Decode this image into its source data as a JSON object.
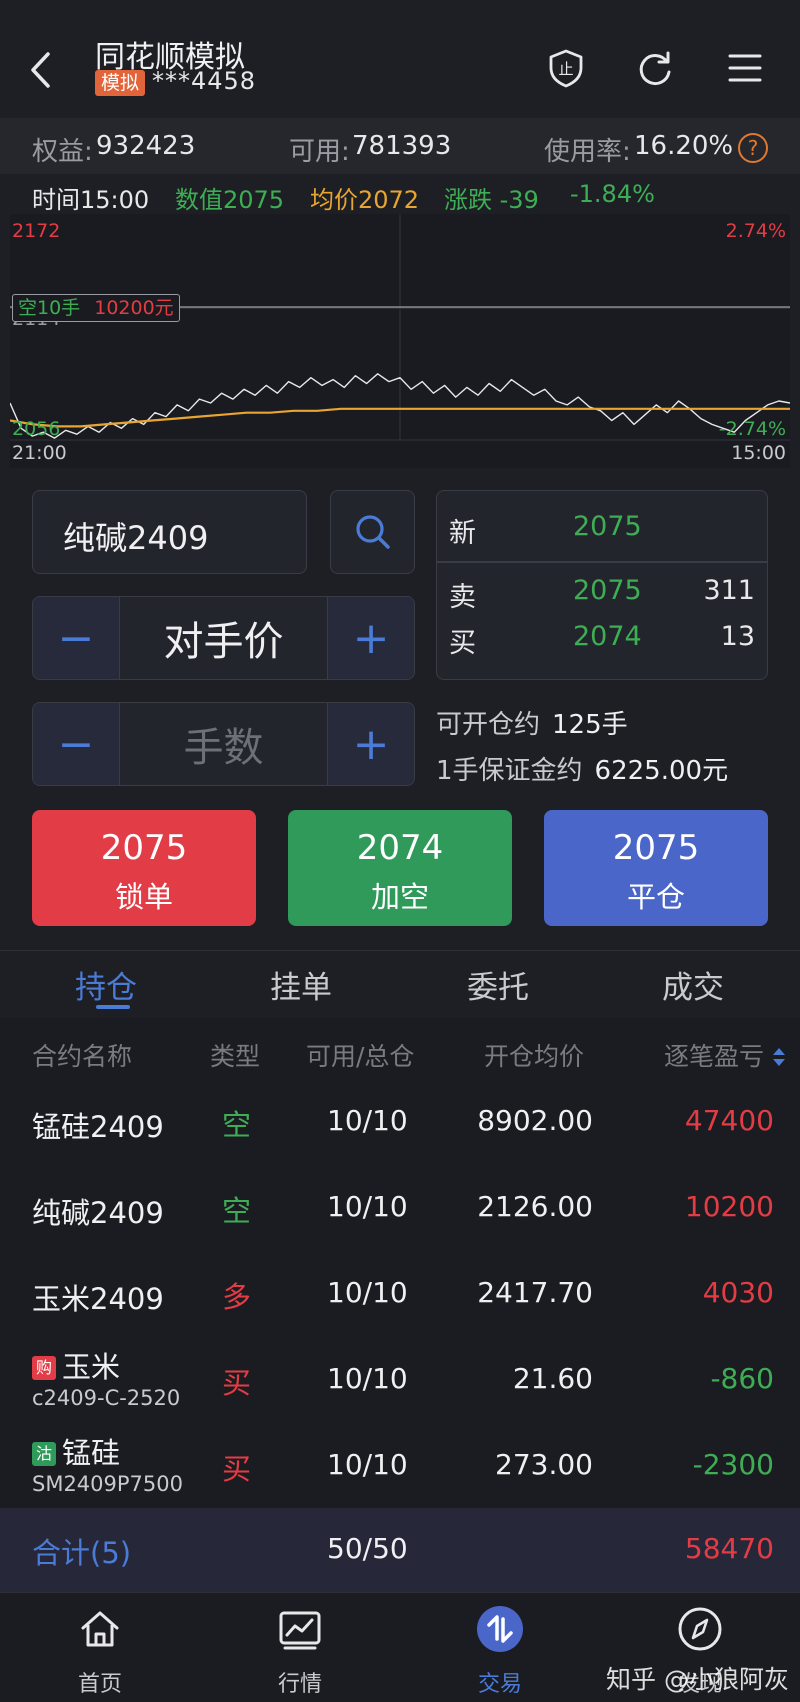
{
  "header": {
    "title": "同花顺模拟",
    "mode_badge": "模拟",
    "account": "***4458"
  },
  "account_bar": {
    "equity_label": "权益:",
    "equity_value": "932423",
    "available_label": "可用:",
    "available_value": "781393",
    "usage_label": "使用率:",
    "usage_value": "16.20%",
    "help": "?"
  },
  "quote_line": {
    "time": "时间15:00",
    "value": "数值2075",
    "avg": "均价2072",
    "change": "涨跌 -39",
    "change_pct": "-1.84%"
  },
  "chart_data": {
    "type": "line",
    "y_top_label": "2172",
    "y_mid_label": "2114",
    "y_bottom_label": "2056",
    "pct_top_label": "2.74%",
    "pct_bottom_label": "-2.74%",
    "x_start_label": "21:00",
    "x_end_label": "15:00",
    "position_tag_side": "空10手",
    "position_tag_value": "10200元",
    "position_line_price": 2126,
    "ylim": [
      2056,
      2172
    ],
    "series": [
      {
        "values": [
          2075,
          2062,
          2058,
          2060,
          2057,
          2061,
          2059,
          2063,
          2060,
          2065,
          2062,
          2067,
          2064,
          2070,
          2068,
          2074,
          2071,
          2077,
          2075,
          2080,
          2077,
          2082,
          2079,
          2084,
          2080,
          2086,
          2083,
          2088,
          2084,
          2087,
          2083,
          2089,
          2085,
          2090,
          2086,
          2088,
          2082,
          2086,
          2080,
          2084,
          2078,
          2083,
          2079,
          2085,
          2081,
          2087,
          2083,
          2079,
          2082,
          2076,
          2074,
          2078,
          2073,
          2071,
          2066,
          2070,
          2064,
          2069,
          2074,
          2070,
          2076,
          2072,
          2067,
          2064,
          2062,
          2060,
          2066,
          2070,
          2074,
          2076,
          2075
        ]
      },
      {
        "values": [
          2066,
          2064,
          2063,
          2063,
          2064,
          2065,
          2066,
          2067,
          2068,
          2069,
          2070,
          2070,
          2071,
          2071,
          2072,
          2072,
          2072,
          2072,
          2072,
          2072,
          2072,
          2072,
          2072,
          2072,
          2072,
          2072,
          2072,
          2072,
          2072,
          2072,
          2072,
          2072,
          2072,
          2072
        ]
      }
    ]
  },
  "order": {
    "contract": "纯碱2409",
    "price_type": "对手价",
    "qty_placeholder": "手数",
    "minus": "−",
    "plus": "+",
    "last_label": "新",
    "last_price": "2075",
    "ask_label": "卖",
    "ask_price": "2075",
    "ask_vol": "311",
    "bid_label": "买",
    "bid_price": "2074",
    "bid_vol": "13",
    "open_label": "可开仓约",
    "open_value": "125手",
    "margin_label": "1手保证金约",
    "margin_value": "6225.00元"
  },
  "actions": [
    {
      "price": "2075",
      "label": "锁单",
      "color": "#e23c47"
    },
    {
      "price": "2074",
      "label": "加空",
      "color": "#2f9a59"
    },
    {
      "price": "2075",
      "label": "平仓",
      "color": "#4a66c9"
    }
  ],
  "tabs": [
    "持仓",
    "挂单",
    "委托",
    "成交"
  ],
  "table": {
    "headers": [
      "合约名称",
      "类型",
      "可用/总仓",
      "开仓均价",
      "逐笔盈亏"
    ],
    "rows": [
      {
        "name": "锰硅2409",
        "type": "空",
        "pos": "10/10",
        "avg": "8902.00",
        "pl": "47400"
      },
      {
        "name": "纯碱2409",
        "type": "空",
        "pos": "10/10",
        "avg": "2126.00",
        "pl": "10200"
      },
      {
        "name": "玉米2409",
        "type": "多",
        "pos": "10/10",
        "avg": "2417.70",
        "pl": "4030"
      },
      {
        "badge": "购",
        "name": "玉米",
        "code": "c2409-C-2520",
        "type": "买",
        "pos": "10/10",
        "avg": "21.60",
        "pl": "-860"
      },
      {
        "badge": "沽",
        "name": "锰硅",
        "code": "SM2409P7500",
        "type": "买",
        "pos": "10/10",
        "avg": "273.00",
        "pl": "-2300"
      }
    ],
    "total_label": "合计(5)",
    "total_pos": "50/50",
    "total_pl": "58470"
  },
  "nav": {
    "items": [
      "首页",
      "行情",
      "交易",
      "发现"
    ],
    "watermark": "知乎 @小狼阿灰"
  },
  "colors": {
    "up": "#e43c44",
    "down": "#3eae55",
    "accent": "#4a7bd6",
    "avg_line": "#e8a531"
  }
}
